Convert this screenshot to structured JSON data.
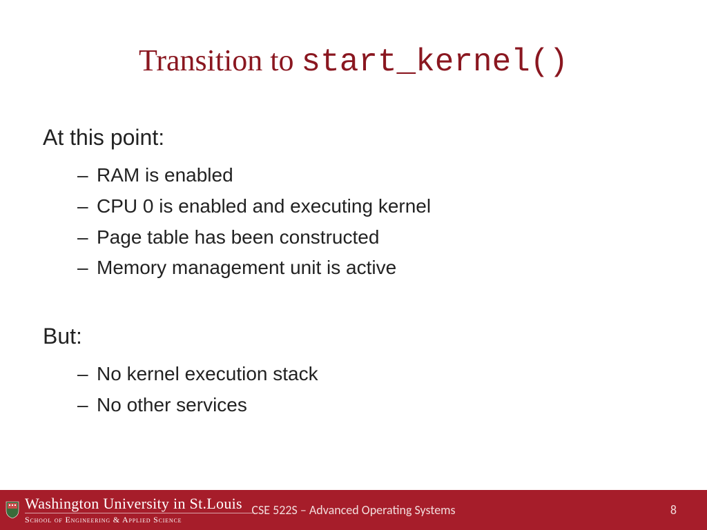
{
  "title": {
    "prefix": "Transition to ",
    "code": "start_kernel()"
  },
  "section1": {
    "heading": "At this point:",
    "items": [
      "RAM is enabled",
      "CPU 0 is enabled and executing kernel",
      "Page table has been constructed",
      "Memory management unit is active"
    ]
  },
  "section2": {
    "heading": "But:",
    "items": [
      "No kernel execution stack",
      "No other services"
    ]
  },
  "footer": {
    "brand_main": "Washington University in St.Louis",
    "brand_sub": "School of Engineering & Applied Science",
    "course": "CSE 522S – Advanced Operating Systems",
    "page": "8"
  }
}
